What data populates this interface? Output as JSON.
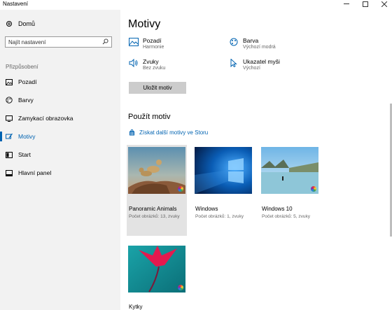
{
  "window": {
    "title": "Nastavení"
  },
  "sidebar": {
    "home_label": "Domů",
    "search_placeholder": "Najít nastavení",
    "section": "Přizpůsobení",
    "items": [
      {
        "label": "Pozadí",
        "icon": "image-icon"
      },
      {
        "label": "Barvy",
        "icon": "palette-icon"
      },
      {
        "label": "Zamykací obrazovka",
        "icon": "lock-screen-icon"
      },
      {
        "label": "Motivy",
        "icon": "brush-icon",
        "active": true
      },
      {
        "label": "Start",
        "icon": "start-icon"
      },
      {
        "label": "Hlavní panel",
        "icon": "taskbar-icon"
      }
    ]
  },
  "main": {
    "title": "Motivy",
    "properties": [
      {
        "label": "Pozadí",
        "value": "Harmonie",
        "icon": "image-icon"
      },
      {
        "label": "Barva",
        "value": "Výchozí modrá",
        "icon": "palette-icon"
      },
      {
        "label": "Zvuky",
        "value": "Bez zvuku",
        "icon": "speaker-icon"
      },
      {
        "label": "Ukazatel myši",
        "value": "Výchozí",
        "icon": "cursor-icon"
      }
    ],
    "save_button": "Uložit motiv",
    "apply_title": "Použít motiv",
    "store_link": "Získat další motivy ve Storu",
    "themes": [
      {
        "name": "Panoramic Animals",
        "count": "Počet obrázků: 13, zvuky",
        "selected": true
      },
      {
        "name": "Windows",
        "count": "Počet obrázků: 1, zvuky"
      },
      {
        "name": "Windows 10",
        "count": "Počet obrázků: 5, zvuky"
      },
      {
        "name": "Kytky",
        "count": ""
      }
    ]
  },
  "colors": {
    "accent": "#0063b1",
    "sidebar_bg": "#f2f2f2",
    "button_bg": "#cccccc"
  }
}
